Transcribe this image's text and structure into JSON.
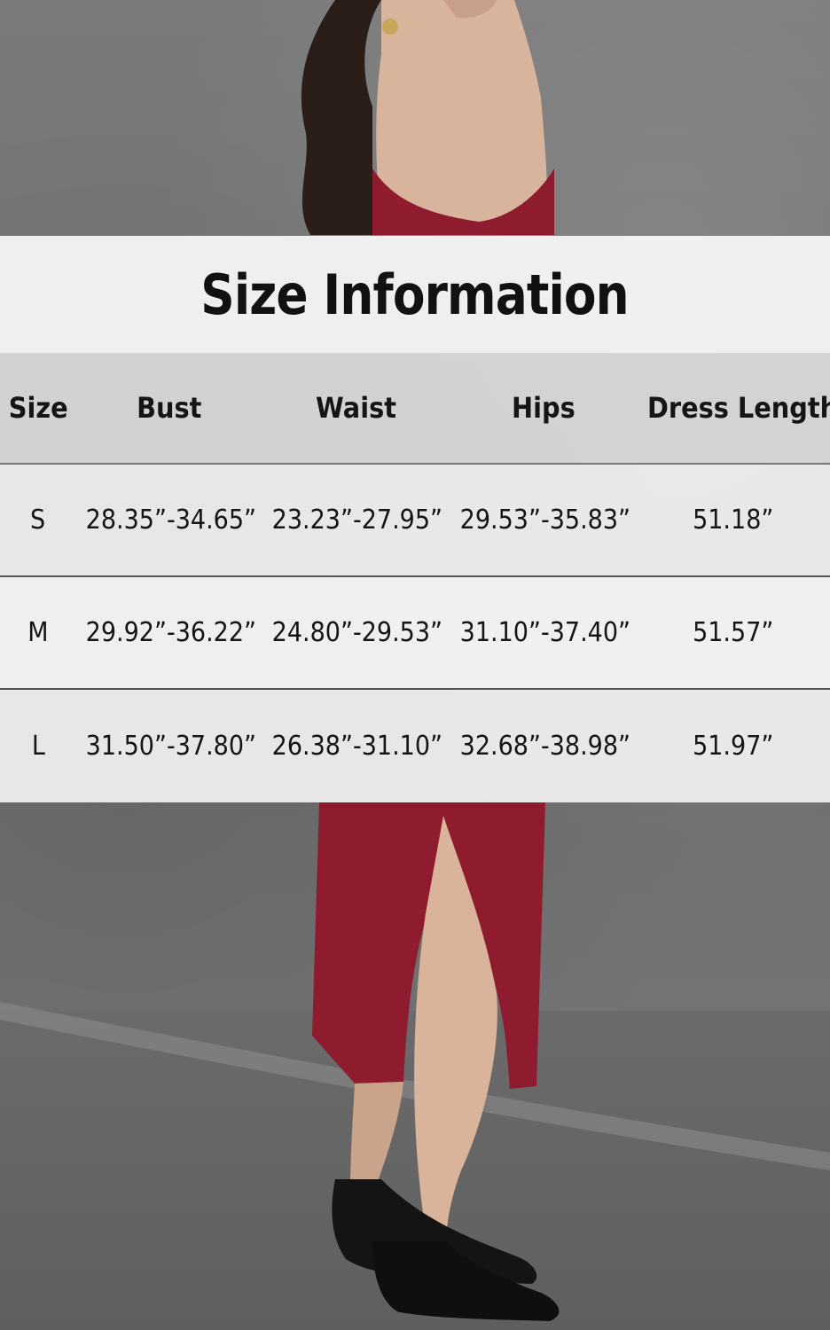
{
  "title": "Size Information",
  "table": {
    "headers": [
      "Size",
      "Bust",
      "Waist",
      "Hips",
      "Dress Length"
    ],
    "rows": [
      [
        "S",
        "28.35”-34.65”",
        "23.23”-27.95”",
        "29.53”-35.83”",
        "51.18”"
      ],
      [
        "M",
        "29.92”-36.22”",
        "24.80”-29.53”",
        "31.10”-37.40”",
        "51.57”"
      ],
      [
        "L",
        "31.50”-37.80”",
        "26.38”-31.10”",
        "32.68”-38.98”",
        "51.97”"
      ]
    ]
  },
  "colors": {
    "dress": "#8e1c2e",
    "wall": "#777777",
    "shoe": "#141414"
  }
}
